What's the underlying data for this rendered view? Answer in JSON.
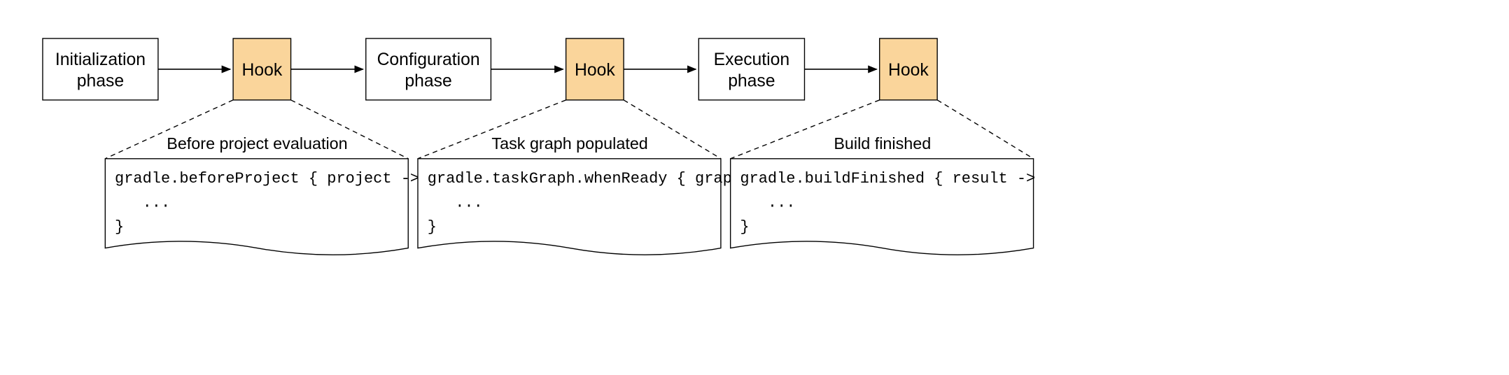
{
  "phases": {
    "init_l1": "Initialization",
    "init_l2": "phase",
    "config_l1": "Configuration",
    "config_l2": "phase",
    "exec_l1": "Execution",
    "exec_l2": "phase"
  },
  "hook_label": "Hook",
  "details": [
    {
      "title": "Before project evaluation",
      "code_l1": "gradle.beforeProject { project ->",
      "code_l2": "   ...",
      "code_l3": "}"
    },
    {
      "title": "Task graph populated",
      "code_l1": "gradle.taskGraph.whenReady { graph ->",
      "code_l2": "   ...",
      "code_l3": "}"
    },
    {
      "title": "Build finished",
      "code_l1": "gradle.buildFinished { result ->",
      "code_l2": "   ...",
      "code_l3": "}"
    }
  ],
  "colors": {
    "hook_fill": "#fad59b",
    "phase_fill": "#ffffff",
    "stroke": "#000000"
  }
}
